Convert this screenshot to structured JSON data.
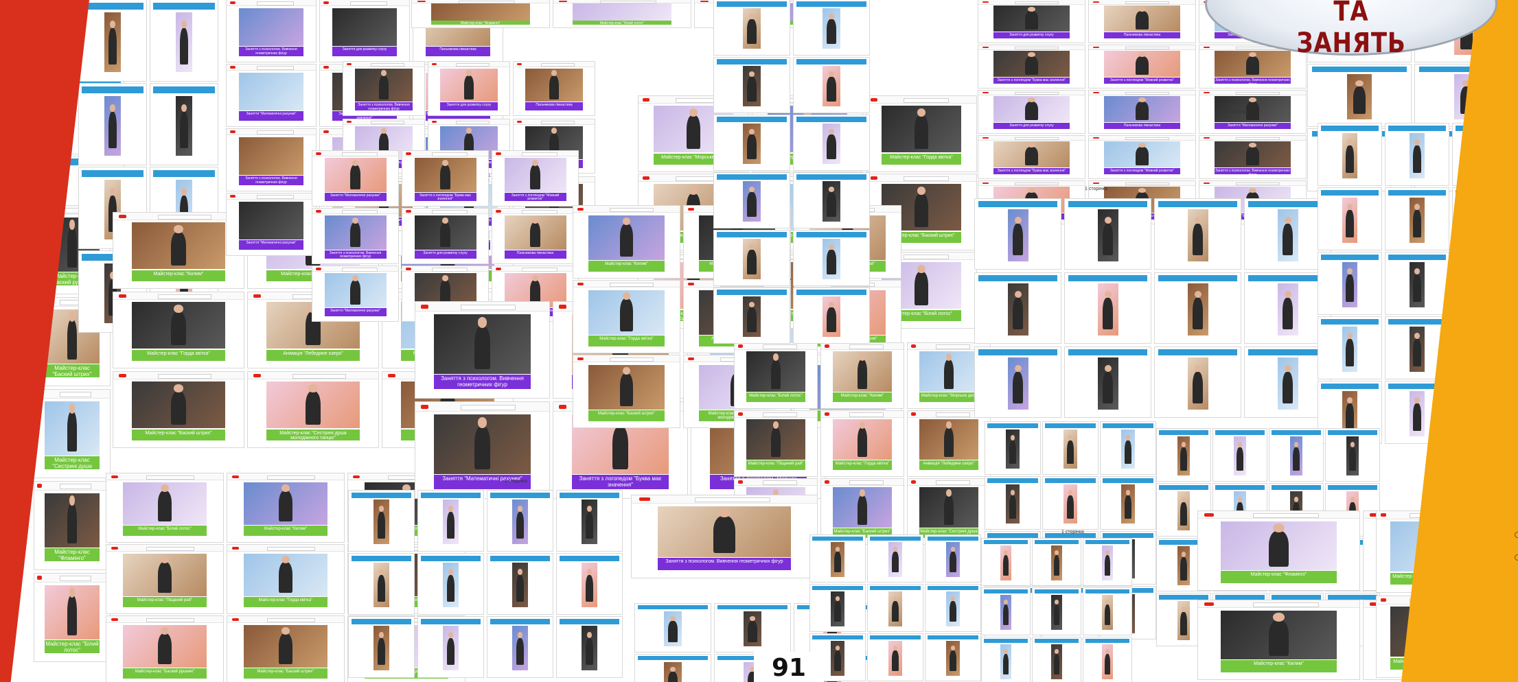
{
  "page": {
    "badge_title": "ТА ЗАНЯТЬ",
    "page_number": "91"
  },
  "colors": {
    "red_band": "#d8301c",
    "orange_band": "#f6a812",
    "caption_green": "#75c63f",
    "caption_purple": "#7a2fd8",
    "phone_header_blue": "#2f9bd6",
    "badge_text": "#8c1010"
  },
  "icons": [
    "youtube-logo-icon",
    "search-bar-icon"
  ],
  "captions": {
    "green": [
      "Майстер-клас \"Баский рушник\"",
      "Майстер-клас \"Баский штрих\"",
      "Майстер-клас \"Сестрині душа молодіжного танцю\"",
      "Майстер-клас \"Фламінго\"",
      "Майстер-клас \"Білий лотос\"",
      "Майстер-клас \"Килим\"",
      "Майстер-клас \"Морське дно\"",
      "Майстер-клас \"Піщаний рай\"",
      "Майстер-клас \"Горда квітка\"",
      "Анімація \"Лебедине озеро\""
    ],
    "purple": [
      "Заняття з психологом. Вивчення геометричних фігур",
      "Заняття для розвитку слуху",
      "Пальчикова гімнастика",
      "Заняття \"Математичні рахунки\"",
      "Заняття з логопедом \"Буква має значення\"",
      "Заняття з логопедом \"Мовний розвиток\""
    ],
    "page_labels": [
      "1 сторінка",
      "1 сторінка",
      "1 сторінка",
      "1 сторінка"
    ]
  }
}
